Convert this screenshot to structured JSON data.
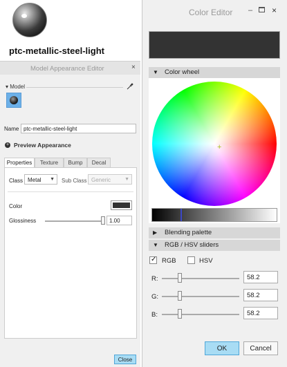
{
  "appearance_preview": {
    "material_name": "ptc-metallic-steel-light"
  },
  "model_appearance_editor": {
    "title": "Model Appearance Editor",
    "close_icon": "×",
    "model_section_label": "▾ Model",
    "eyedropper_icon": "eyedropper-icon",
    "name_label": "Name",
    "name_value": "ptc-metallic-steel-light",
    "preview_appearance_label": "Preview Appearance",
    "tabs": [
      {
        "label": "Properties",
        "active": true
      },
      {
        "label": "Texture",
        "active": false
      },
      {
        "label": "Bump",
        "active": false
      },
      {
        "label": "Decal",
        "active": false
      }
    ],
    "properties": {
      "class_label": "Class",
      "class_value": "Metal",
      "subclass_label": "Sub Class",
      "subclass_value": "Generic",
      "color_label": "Color",
      "color_value": "#333333",
      "glossiness_label": "Glossiness",
      "glossiness_value": "1.00",
      "glossiness_level": 1.0
    },
    "close_label": "Close"
  },
  "color_editor": {
    "title": "Color Editor",
    "minimize_icon": "–",
    "maximize_icon": "maximize-icon",
    "close_icon": "×",
    "preview_color": "#333333",
    "color_wheel_label": "Color wheel",
    "value_bar_level": 0.23,
    "blending_palette_label": "Blending palette",
    "rgb_hsv_label": "RGB / HSV sliders",
    "rgb_label": "RGB",
    "rgb_checked": true,
    "hsv_label": "HSV",
    "hsv_checked": false,
    "sliders": [
      {
        "label": "R:",
        "value": "58.2",
        "level": 0.228
      },
      {
        "label": "G:",
        "value": "58.2",
        "level": 0.228
      },
      {
        "label": "B:",
        "value": "58.2",
        "level": 0.228
      }
    ],
    "ok_label": "OK",
    "cancel_label": "Cancel"
  }
}
